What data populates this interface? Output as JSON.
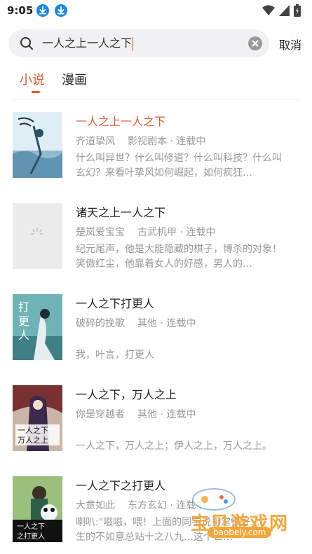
{
  "status_bar": {
    "time": "9:05"
  },
  "search": {
    "query": "一人之上一人之下",
    "cancel_label": "取消"
  },
  "tabs": [
    {
      "label": "小说",
      "active": true
    },
    {
      "label": "漫画",
      "active": false
    }
  ],
  "results": [
    {
      "title": "一人之上一人之下",
      "author": "齐道挚风",
      "genre": "影视剧本 · 连载中",
      "description": "什么叫异世？什么叫修道？什么叫科技？什么叫玄幻？来看叶挚风如何崛起，如何疯狂…",
      "highlighted": true
    },
    {
      "title": "诸天之上一人之下",
      "author": "楚岚爱宝宝",
      "genre": "古武机甲 · 连载中",
      "description": "纪元尾声，他是大能隐藏的棋子，博杀的对象！笑傲红尘，他靠着女人的好感，男人的…",
      "highlighted": false
    },
    {
      "title": "一人之下打更人",
      "author": "破碎的挽歌",
      "genre": "其他 · 连载中",
      "description": "\n我，叶言，打更人",
      "highlighted": false
    },
    {
      "title": "一人之下，万人之上",
      "author": "你是穿越者",
      "genre": "其他 · 连载中",
      "description": "\n一人之下，万人之上；伊人之上，万人之上。",
      "highlighted": false
    },
    {
      "title": "一人之下之打更人",
      "author": "大意如此",
      "genre": "东方玄幻 · 连载中",
      "description": "喇叭:\"嗞嗞，喂！上面的同学说平常很好…\n生的不如意总站十之八九…这个世…",
      "highlighted": false
    }
  ],
  "cover_text": {
    "book3": "打更人",
    "book4": "一人之下万人之上",
    "book5": "一人之下之打更人"
  },
  "watermark": {
    "title": "宝贝游戏网",
    "url": "baobeiy.com"
  },
  "colors": {
    "accent": "#e35a2b",
    "muted": "#999999",
    "download_badge": "#1e88e5"
  }
}
